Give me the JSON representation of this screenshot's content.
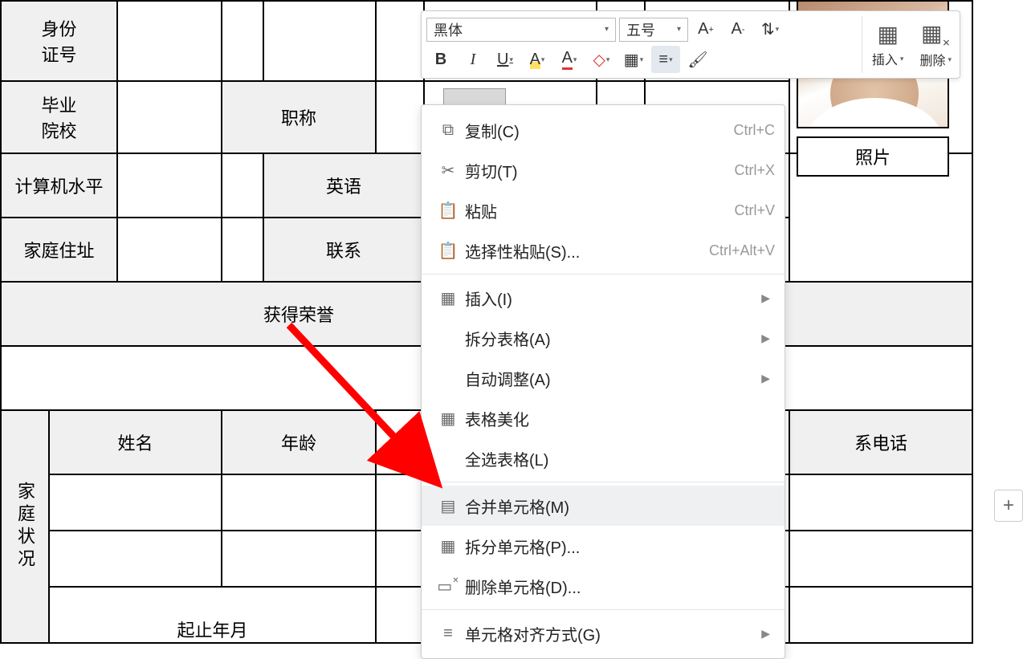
{
  "table": {
    "id_label_1": "身份",
    "id_label_2": "证号",
    "grad_school_1": "毕业",
    "grad_school_2": "院校",
    "title_label": "职称",
    "computer_label": "计算机水平",
    "english_label": "英语",
    "address_label": "家庭住址",
    "contact_label": "联系",
    "honors_label": "获得荣誉",
    "family_label": "家庭状况",
    "name_label": "姓名",
    "age_label": "年龄",
    "phone_label": "系电话",
    "photo_label": "照片",
    "start_end_partial": "起止年月"
  },
  "toolbar": {
    "font_name": "黑体",
    "font_size": "五号",
    "insert_label": "插入",
    "delete_label": "删除"
  },
  "context_menu": {
    "copy": "复制(C)",
    "copy_sc": "Ctrl+C",
    "cut": "剪切(T)",
    "cut_sc": "Ctrl+X",
    "paste": "粘贴",
    "paste_sc": "Ctrl+V",
    "paste_special": "选择性粘贴(S)...",
    "paste_special_sc": "Ctrl+Alt+V",
    "insert": "插入(I)",
    "split_table": "拆分表格(A)",
    "auto_fit": "自动调整(A)",
    "beautify": "表格美化",
    "select_all": "全选表格(L)",
    "merge_cells": "合并单元格(M)",
    "split_cells": "拆分单元格(P)...",
    "delete_cells": "删除单元格(D)...",
    "cell_align": "单元格对齐方式(G)"
  }
}
